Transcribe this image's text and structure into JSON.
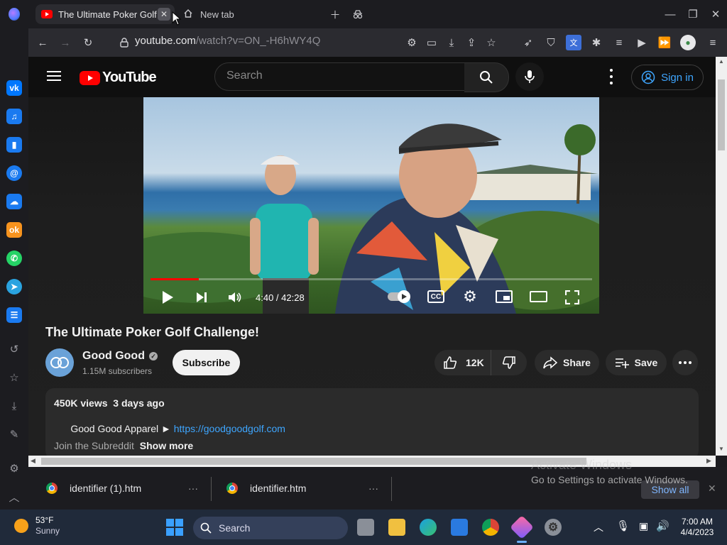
{
  "browser": {
    "tabs": [
      {
        "label": "The Ultimate Poker Golf C",
        "active": true
      },
      {
        "label": "New tab",
        "active": false
      }
    ],
    "url_host": "youtube.com",
    "url_path": "/watch?v=ON_-H6hWY4Q"
  },
  "youtube": {
    "logo_text": "YouTube",
    "search_placeholder": "Search",
    "sign_in": "Sign in",
    "player": {
      "time": "4:40 / 42:28",
      "progress": 0.11
    },
    "video_title": "The Ultimate Poker Golf Challenge!",
    "channel": {
      "name": "Good Good",
      "subscribers": "1.15M subscribers",
      "subscribe_label": "Subscribe"
    },
    "actions": {
      "likes": "12K",
      "share": "Share",
      "save": "Save"
    },
    "description": {
      "stats": "450K views  3 days ago",
      "line1_prefix": "Good Good Apparel ► ",
      "line1_link": "https://goodgoodgolf.com",
      "line2": "Join the Subreddit",
      "show_more": "Show more"
    }
  },
  "watermark": {
    "title": "Activate Windows",
    "subtitle": "Go to Settings to activate Windows."
  },
  "downloads": {
    "items": [
      "identifier (1).htm",
      "identifier.htm"
    ],
    "show_all": "Show all"
  },
  "taskbar": {
    "weather_temp": "53°F",
    "weather_desc": "Sunny",
    "search_label": "Search",
    "time": "7:00 AM",
    "date": "4/4/2023"
  },
  "colors": {
    "accent_red": "#ff0000",
    "link_blue": "#3ea6ff"
  }
}
